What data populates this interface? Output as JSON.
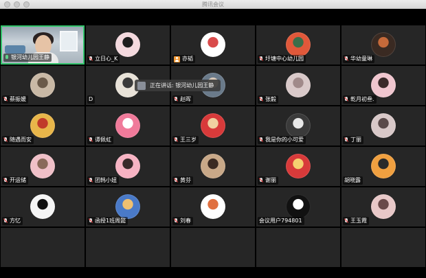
{
  "window": {
    "title": "腾讯会议"
  },
  "speaking_banner": {
    "text": "正在讲话: 银河幼儿园王静"
  },
  "colors": {
    "active_border": "#32c46b",
    "tile_bg": "#262626"
  },
  "participants": [
    {
      "name": "银河幼儿园王静",
      "mic": "on",
      "video": true,
      "avatar": [
        "#7d8a96",
        "#c9d2d9"
      ]
    },
    {
      "name": "立日心_K",
      "mic": "muted",
      "avatar": [
        "#f4d9de",
        "#1d1d1d"
      ]
    },
    {
      "name": "亦韬",
      "mic": "person",
      "avatar": [
        "#ffffff",
        "#d94b4b"
      ]
    },
    {
      "name": "圩塘中心幼儿园",
      "mic": "muted",
      "avatar": [
        "#e0583a",
        "#3a6e4a"
      ]
    },
    {
      "name": "华幼童琳",
      "mic": "muted",
      "avatar": [
        "#3a2a22",
        "#c66a3a"
      ]
    },
    {
      "name": "蔡振媛",
      "mic": "muted",
      "avatar": [
        "#c9b9a6",
        "#6a5a4a"
      ]
    },
    {
      "name": "D",
      "mic": "none",
      "avatar": [
        "#e8e2d8",
        "#3a3a3a"
      ]
    },
    {
      "name": "赵晖",
      "mic": "muted",
      "avatar": [
        "#6a7a8a",
        "#d8c8b8"
      ]
    },
    {
      "name": "张毅",
      "mic": "muted",
      "avatar": [
        "#d9c9c9",
        "#a08a8a"
      ]
    },
    {
      "name": "乾月初叁.",
      "mic": "muted",
      "avatar": [
        "#f0c6cf",
        "#3a2a2a"
      ]
    },
    {
      "name": "随遇而安",
      "mic": "muted",
      "avatar": [
        "#e8b64a",
        "#c03a2a"
      ]
    },
    {
      "name": "谭佩虹",
      "mic": "muted",
      "avatar": [
        "#f07a9a",
        "#ffffff"
      ]
    },
    {
      "name": "王三岁",
      "mic": "muted",
      "avatar": [
        "#d83a3a",
        "#f0d0a0"
      ]
    },
    {
      "name": "我是你的小可爱",
      "mic": "muted",
      "avatar": [
        "#3a3a3a",
        "#e8e8e8"
      ]
    },
    {
      "name": "丁丽",
      "mic": "muted",
      "avatar": [
        "#d8c8c8",
        "#5a4a4a"
      ]
    },
    {
      "name": "开运储",
      "mic": "muted",
      "avatar": [
        "#f0c0c8",
        "#8a6a5a"
      ]
    },
    {
      "name": "团韩小妞",
      "mic": "muted",
      "avatar": [
        "#f7b3c3",
        "#3a2a2a"
      ]
    },
    {
      "name": "黄芬",
      "mic": "muted",
      "avatar": [
        "#c8a888",
        "#3a2a22"
      ]
    },
    {
      "name": "谢丽",
      "mic": "muted",
      "avatar": [
        "#d83a3a",
        "#f5d070"
      ]
    },
    {
      "name": "胡晓露",
      "mic": "none",
      "avatar": [
        "#f0a040",
        "#2a2a2a"
      ]
    },
    {
      "name": "方忆",
      "mic": "muted",
      "avatar": [
        "#f5f5f5",
        "#111111"
      ]
    },
    {
      "name": "函授1班周懿",
      "mic": "muted",
      "avatar": [
        "#4a7ac8",
        "#f0c070"
      ]
    },
    {
      "name": "刘春",
      "mic": "muted",
      "avatar": [
        "#ffffff",
        "#e07040"
      ]
    },
    {
      "name": "会议用户794801",
      "mic": "none",
      "avatar": [
        "#111111",
        "#ffffff"
      ]
    },
    {
      "name": "王玉霞",
      "mic": "muted",
      "avatar": [
        "#e8c8c8",
        "#6a4a4a"
      ]
    }
  ]
}
